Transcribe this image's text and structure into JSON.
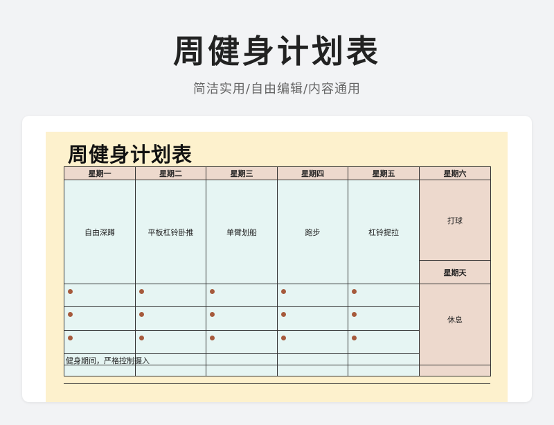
{
  "header": {
    "title": "周健身计划表",
    "subtitle": "简洁实用/自由编辑/内容通用"
  },
  "sheet": {
    "title": "周健身计划表",
    "days": [
      "星期一",
      "星期二",
      "星期三",
      "星期四",
      "星期五",
      "星期六"
    ],
    "workouts": [
      "自由深蹲",
      "平板杠铃卧推",
      "单臂划船",
      "跑步",
      "杠铃提拉"
    ],
    "saturday_activity": "打球",
    "sunday_label": "星期天",
    "sunday_activity": "休息",
    "bullet_rows": 3,
    "note": "健身期间，严格控制摄入"
  },
  "colors": {
    "page_bg": "#f2f3f5",
    "sheet_bg": "#fdf1cd",
    "header_cell": "#edd9cd",
    "plan_cell": "#e6f5f3",
    "bullet": "#a65a3c"
  }
}
